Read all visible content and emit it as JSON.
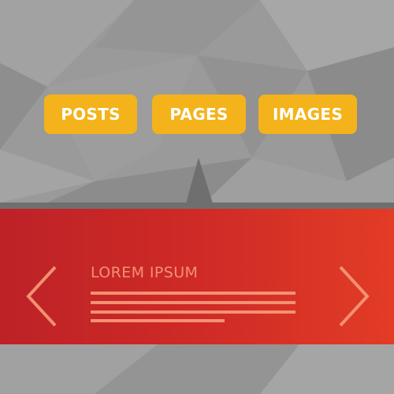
{
  "nav": {
    "buttons": [
      {
        "label": "POSTS"
      },
      {
        "label": "PAGES"
      },
      {
        "label": "IMAGES"
      }
    ]
  },
  "slider": {
    "title": "LOREM IPSUM",
    "prev_icon": "chevron-left-icon",
    "next_icon": "chevron-right-icon"
  },
  "colors": {
    "background": "#9b9a9a",
    "button": "#f4b31a",
    "button_text": "#ffffff",
    "slider_start": "#bd2227",
    "slider_end": "#e23c26",
    "slider_text": "#f39172"
  }
}
